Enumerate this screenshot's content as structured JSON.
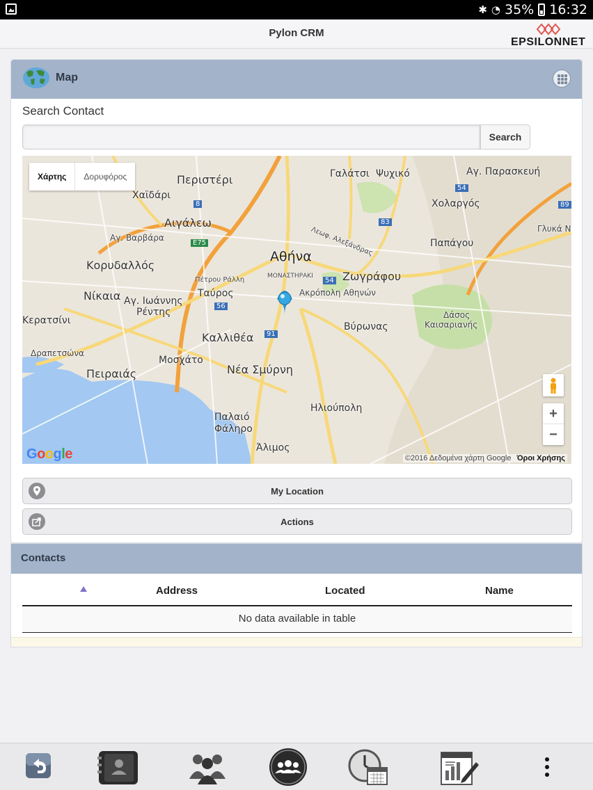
{
  "status_bar": {
    "battery": "35%",
    "time": "16:32"
  },
  "app": {
    "title": "Pylon CRM",
    "brand": "EPSILONNET"
  },
  "map_panel": {
    "title": "Map",
    "search_label": "Search Contact",
    "search_value": "",
    "search_button": "Search",
    "map": {
      "type_map": "Χάρτης",
      "type_satellite": "Δορυφόρος",
      "google_logo": "Google",
      "credit": "©2016 Δεδομένα χάρτη Google",
      "terms": "Όροι Χρήσης",
      "zoom_in": "+",
      "zoom_out": "−",
      "labels": {
        "peristeri": "Περιστέρι",
        "galatsi": "Γαλάτσι",
        "psychiko": "Ψυχικό",
        "ag_paraskevi": "Αγ. Παρασκευή",
        "chaidari": "Χαϊδάρι",
        "cholargos": "Χολαργός",
        "aigaleo": "Αιγάλεω",
        "ag_varvara": "Αγ. Βαρβάρα",
        "glyka_nera": "Γλυκά Νε",
        "papagou": "Παπάγου",
        "korydallos": "Κορυδαλλός",
        "athina": "Αθήνα",
        "monastiraki": "ΜΟΝΑΣΤΗΡΑΚΙ",
        "zografou": "Ζωγράφου",
        "nikaia": "Νίκαια",
        "ag_ioannis": "Αγ. Ιωάννης",
        "rentis": "Ρέντης",
        "tavros": "Ταύρος",
        "acropolis": "Ακρόπολη Αθηνών",
        "keratsini": "Κερατσίνι",
        "kallithea": "Καλλιθέα",
        "vyronas": "Βύρωνας",
        "dasos": "Δάσος",
        "kaisariani": "Καισαριανής",
        "drapetsona": "Δραπετσώνα",
        "moschato": "Μοσχάτο",
        "peiraias": "Πειραιάς",
        "nea_smyrni": "Νέα Σμύρνη",
        "ilioupoli": "Ηλιούπολη",
        "palaio_faliro_1": "Παλαιό",
        "palaio_faliro_2": "Φάληρο",
        "alimos": "Άλιμος",
        "petrou_ralli": "Πέτρου Ράλλη",
        "leof_alexandras": "Λεωφ. Αλεξάνδρας"
      },
      "shields": {
        "r8": "8",
        "rE75": "E75",
        "r56": "56",
        "r91": "91",
        "r54a": "54",
        "r54b": "54",
        "r83": "83",
        "r89": "89"
      }
    },
    "my_location_button": "My Location",
    "actions_button": "Actions"
  },
  "contacts": {
    "title": "Contacts",
    "columns": [
      "Address",
      "Located",
      "Name"
    ],
    "empty_message": "No data available in table"
  },
  "colors": {
    "panel_header": "#a3b3c9",
    "sort_arrow": "#7e74c9",
    "sea": "#a3c8f1",
    "park": "#c6dfa8",
    "highway": "#f2a13c",
    "major_road": "#f7d87a"
  },
  "bottom_nav": [
    "back-icon",
    "contacts-book-icon",
    "users-icon",
    "group-circle-icon",
    "schedule-icon",
    "report-icon",
    "more-vert-icon"
  ]
}
